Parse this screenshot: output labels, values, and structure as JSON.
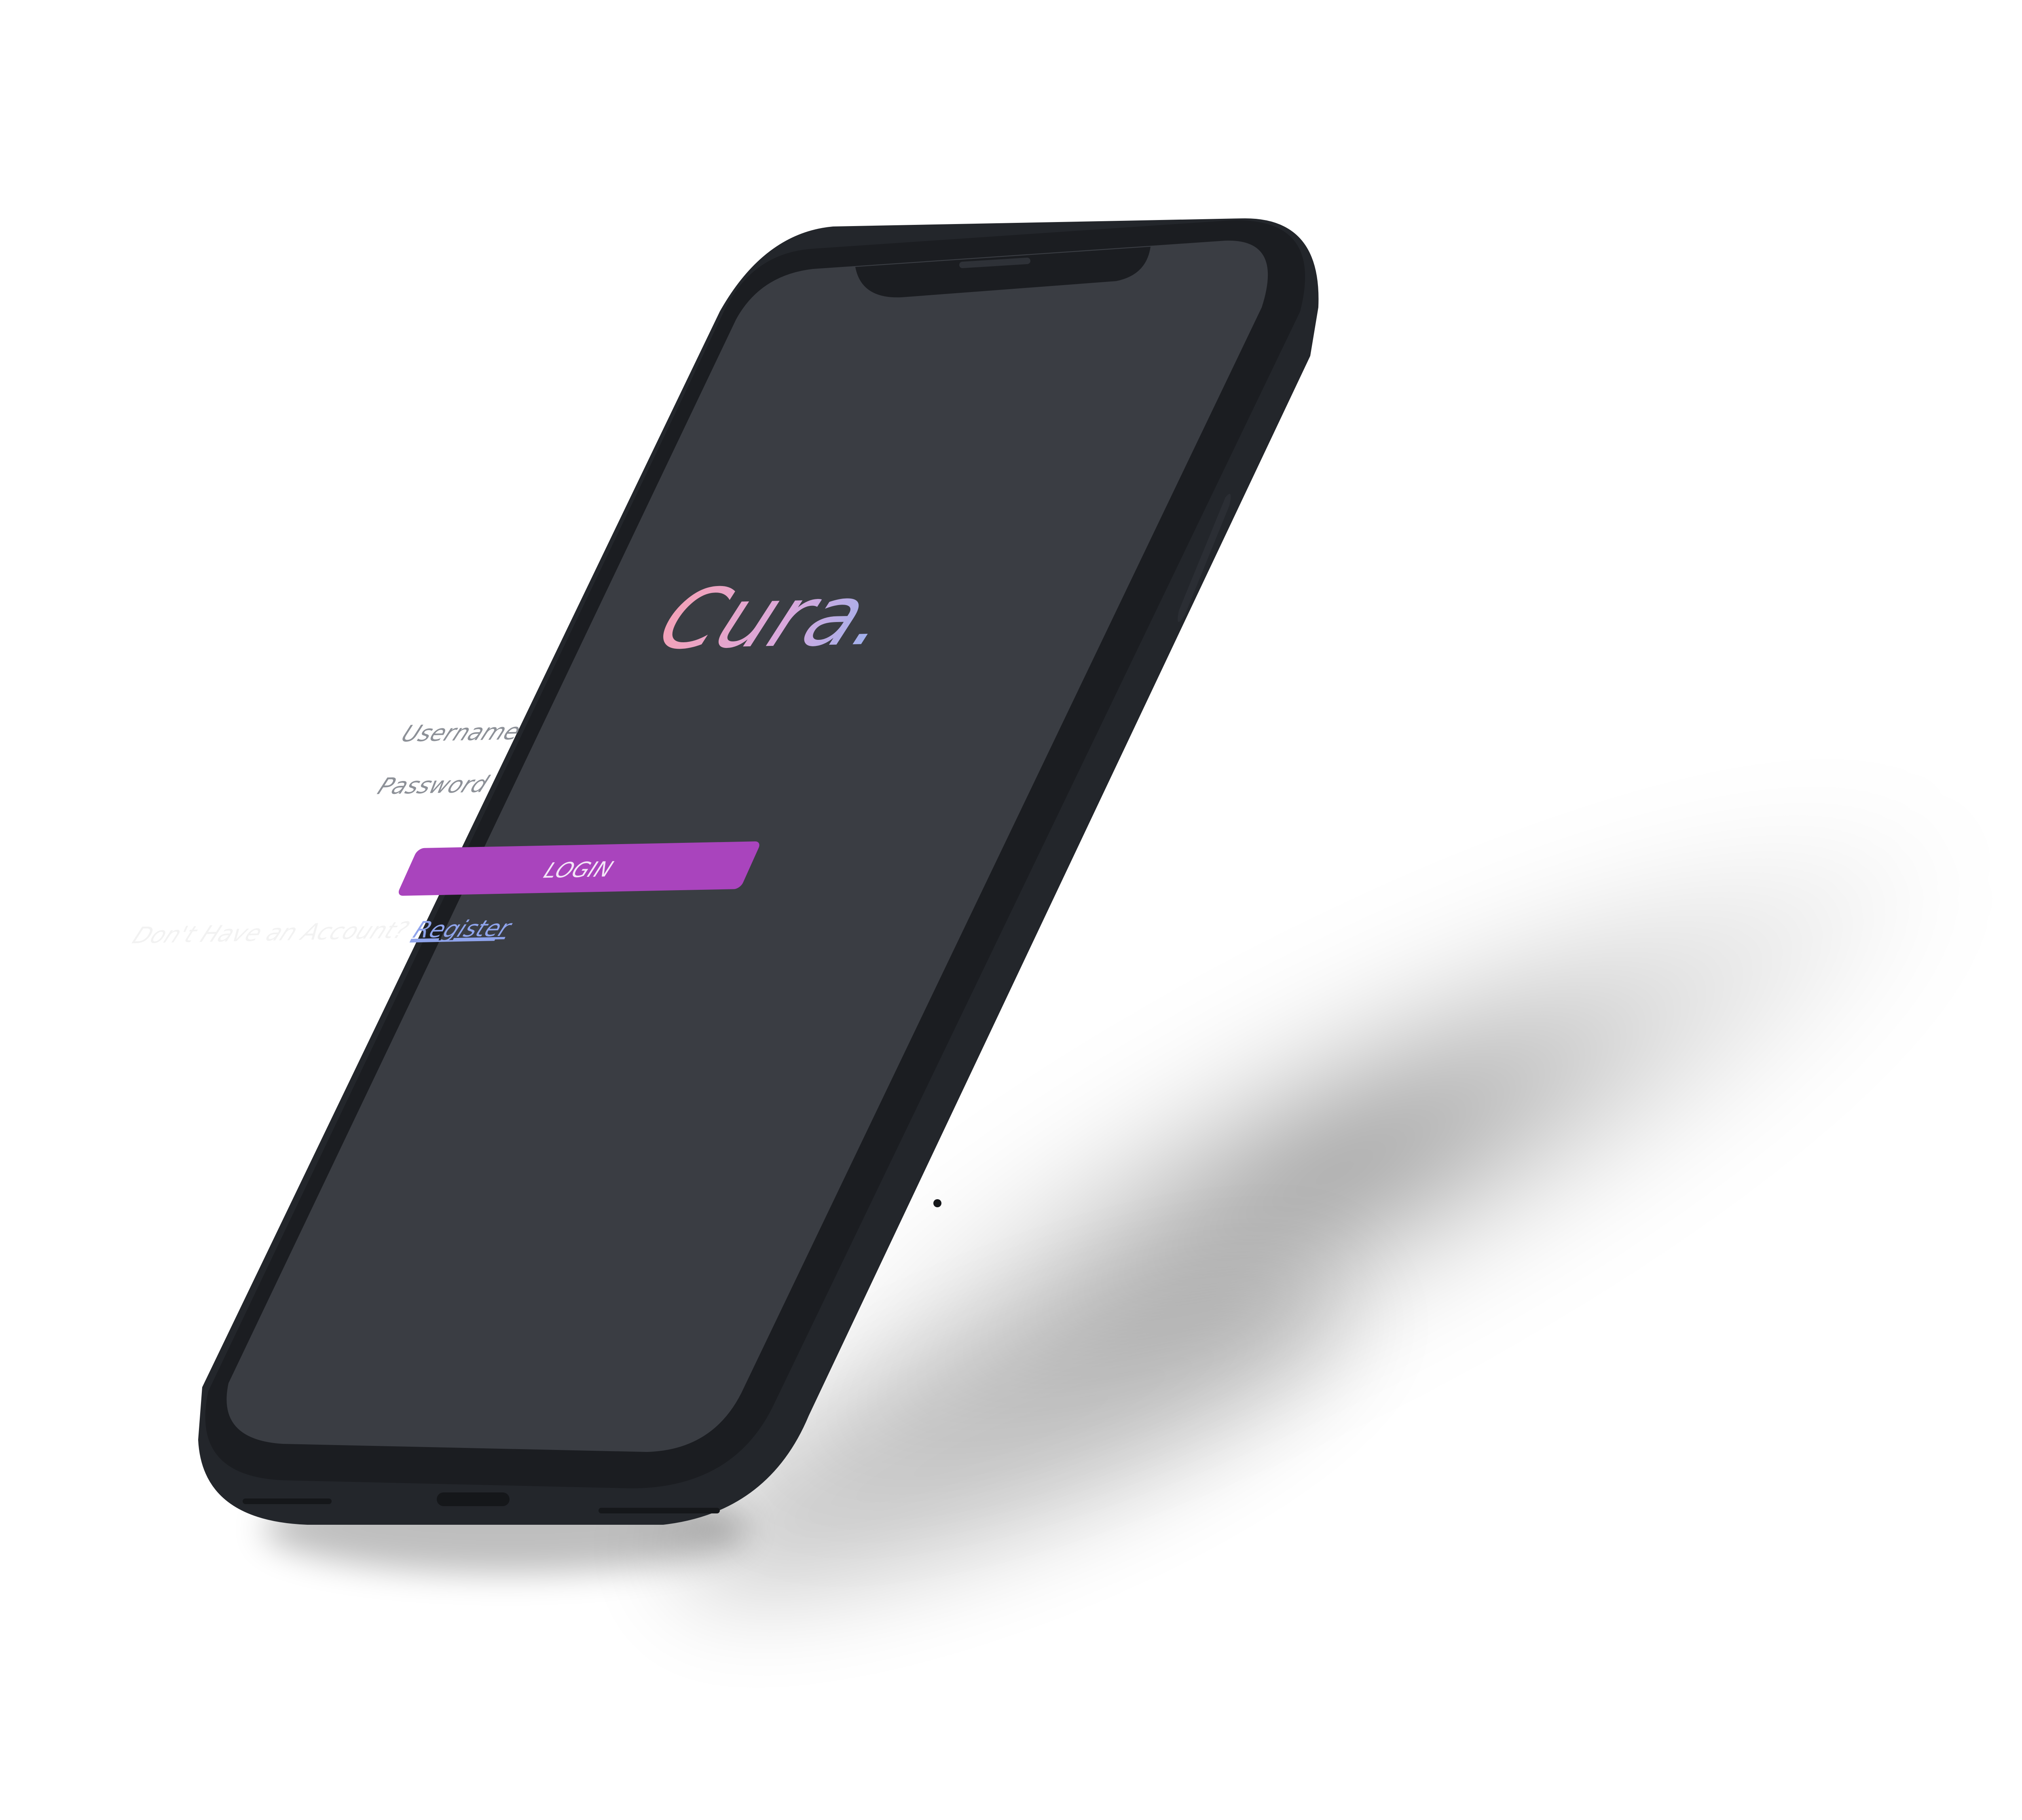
{
  "app": {
    "brand_name": "Cura.",
    "brand_gradient": [
      "#f4a2b7",
      "#d9a8dc",
      "#9bb1ee"
    ],
    "brand_period_color": "#8aa6ee"
  },
  "login_form": {
    "username_placeholder": "Username",
    "password_placeholder": "Password",
    "login_label": "LOGIN",
    "login_color": "#a944bd",
    "no_account_text": "Don't Have an Account?",
    "register_link": "Register",
    "register_color": "#8fa4ec"
  },
  "theme": {
    "screen_color": "#3a3d43",
    "frame_color": "#1d1f23",
    "frame_edge_color": "#262930",
    "background": "#ffffff"
  }
}
